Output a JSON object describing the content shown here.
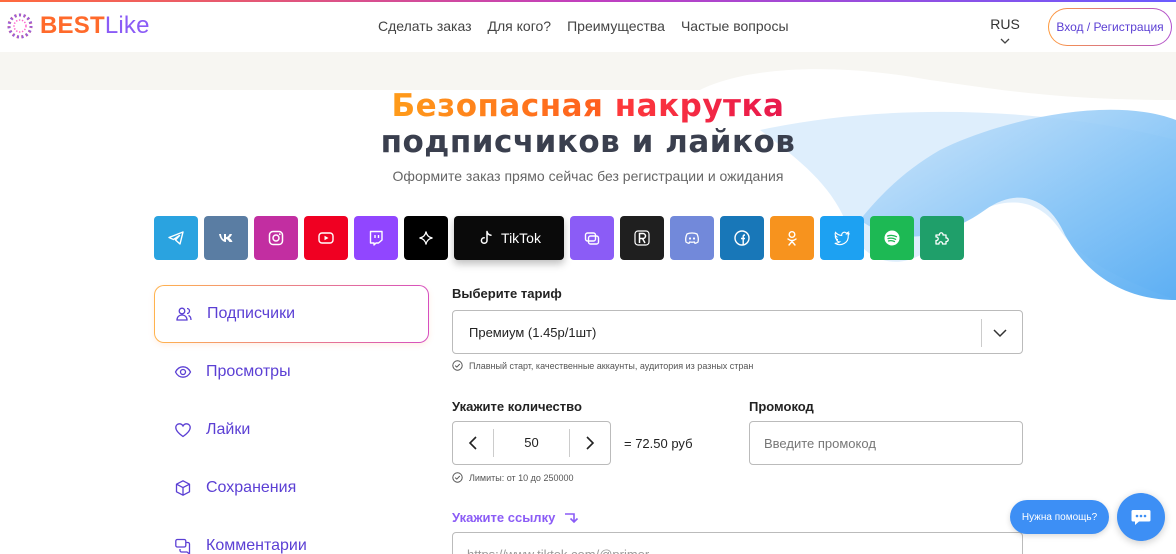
{
  "brand": {
    "best": "BEST",
    "like": "Like"
  },
  "nav": [
    "Сделать заказ",
    "Для кого?",
    "Преимущества",
    "Частые вопросы"
  ],
  "lang": "RUS",
  "login_label": "Вход / Регистрация",
  "hero": {
    "line1a": "Безопасная ",
    "line1b": "накрутка",
    "line2": "подписчиков и лайков",
    "subtitle": "Оформите заказ прямо сейчас без регистрации и ожидания"
  },
  "socials": [
    {
      "name": "telegram",
      "color": "#2aa3e0"
    },
    {
      "name": "vk",
      "color": "#5a7da3"
    },
    {
      "name": "instagram",
      "color": "#c22ea1"
    },
    {
      "name": "youtube",
      "color": "#f00022"
    },
    {
      "name": "twitch",
      "color": "#9146ff"
    },
    {
      "name": "threads",
      "color": "#000000"
    },
    {
      "name": "tiktok",
      "color": "#0a0a0a",
      "label": "TikTok",
      "active": true
    },
    {
      "name": "likee",
      "color": "#8b5cf6"
    },
    {
      "name": "rutube",
      "color": "#1f1f1f"
    },
    {
      "name": "discord",
      "color": "#7289da"
    },
    {
      "name": "facebook",
      "color": "#1877b8"
    },
    {
      "name": "odnoklassniki",
      "color": "#f7931e"
    },
    {
      "name": "twitter",
      "color": "#1da1f2"
    },
    {
      "name": "spotify",
      "color": "#1db954"
    },
    {
      "name": "other",
      "color": "#1f9f6a"
    }
  ],
  "menu": [
    {
      "label": "Подписчики",
      "icon": "users-icon",
      "active": true
    },
    {
      "label": "Просмотры",
      "icon": "eye-icon"
    },
    {
      "label": "Лайки",
      "icon": "heart-icon"
    },
    {
      "label": "Сохранения",
      "icon": "box-icon"
    },
    {
      "label": "Комментарии",
      "icon": "comments-icon"
    }
  ],
  "form": {
    "tariff_label": "Выберите тариф",
    "tariff_value": "Премиум (1.45р/1шт)",
    "tariff_hint": "Плавный старт, качественные аккаунты, аудитория из разных стран",
    "quantity_label": "Укажите количество",
    "quantity_value": "50",
    "total": "= 72.50 руб",
    "limits_hint": "Лимиты: от 10 до 250000",
    "promo_label": "Промокод",
    "promo_placeholder": "Введите промокод",
    "link_label": "Укажите ссылку",
    "link_placeholder": "https://www.tiktok.com/@primer"
  },
  "help_label": "Нужна помощь?",
  "colors": {
    "accent": "#8b5cf6",
    "help": "#3d8ff5",
    "orange": "#ff6a2b"
  }
}
